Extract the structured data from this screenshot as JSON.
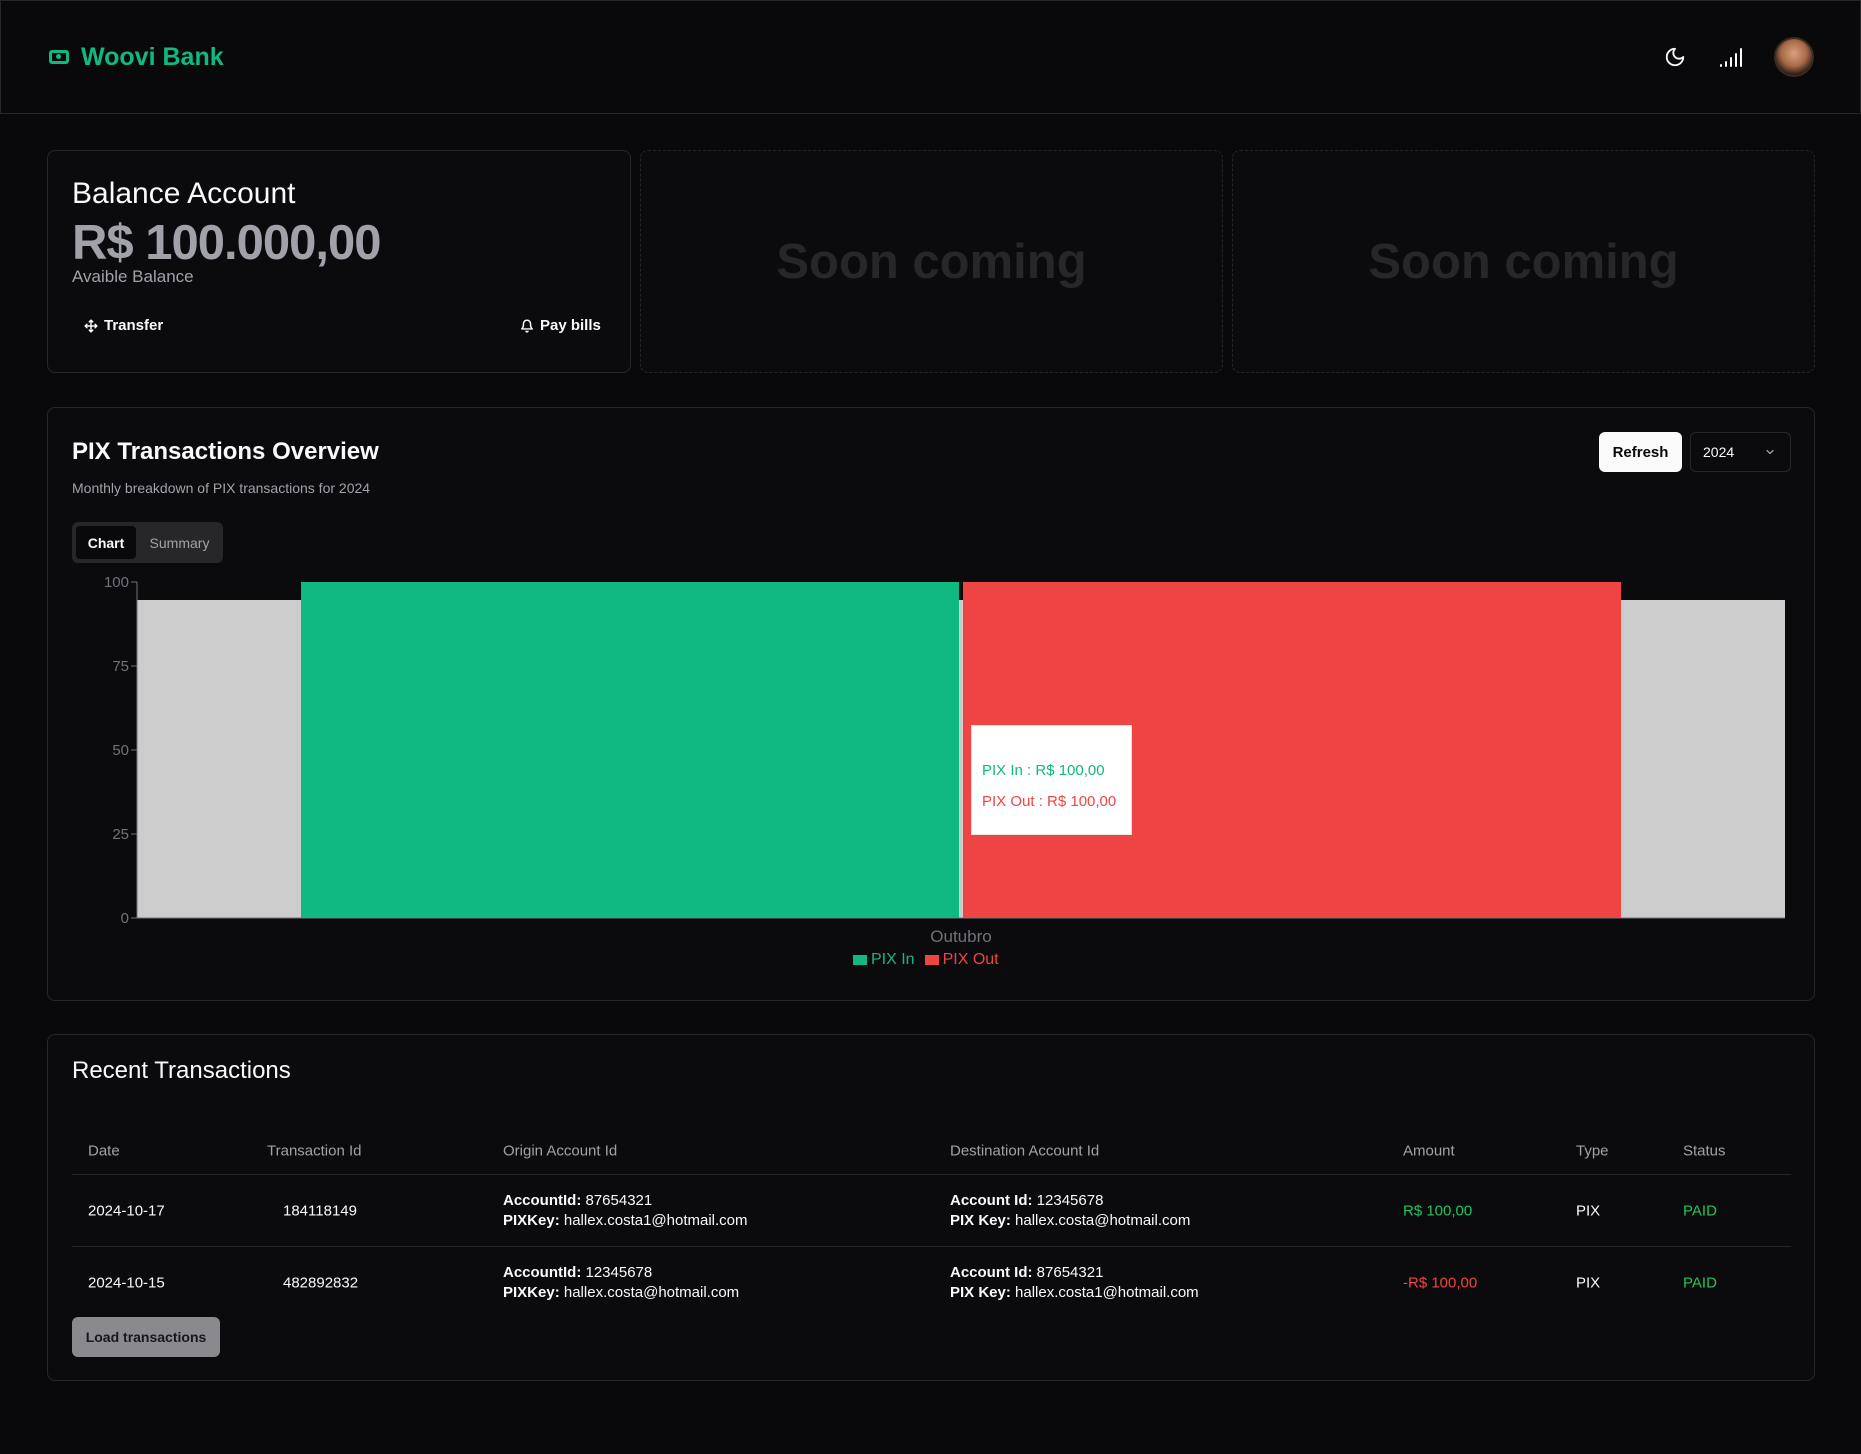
{
  "header": {
    "brand": "Woovi Bank",
    "icons": [
      "money-icon",
      "moon-icon",
      "signal-icon"
    ]
  },
  "balance": {
    "title": "Balance Account",
    "amount": "R$ 100.000,00",
    "subtitle": "Avaible Balance",
    "transfer_label": "Transfer",
    "pay_bills_label": "Pay bills"
  },
  "placeholders": {
    "soon_1": "Soon coming",
    "soon_2": "Soon coming"
  },
  "overview": {
    "title": "PIX Transactions Overview",
    "subtitle": "Monthly breakdown of PIX transactions for 2024",
    "refresh_label": "Refresh",
    "year_selected": "2024",
    "tabs": [
      {
        "label": "Chart",
        "active": true
      },
      {
        "label": "Summary",
        "active": false
      }
    ],
    "tooltip": {
      "title": "Outubro",
      "pix_in": "PIX In : R$ 100,00",
      "pix_out": "PIX Out : R$ 100,00"
    }
  },
  "chart_data": {
    "type": "bar",
    "categories": [
      "Outubro"
    ],
    "series": [
      {
        "name": "PIX In",
        "values": [
          100
        ],
        "color": "#10b981"
      },
      {
        "name": "PIX Out",
        "values": [
          100
        ],
        "color": "#ef4444"
      }
    ],
    "ylim": [
      0,
      100
    ],
    "yticks": [
      0,
      25,
      50,
      75,
      100
    ],
    "legend": "bottom",
    "grid": false
  },
  "transactions": {
    "title": "Recent Transactions",
    "columns": [
      "Date",
      "Transaction Id",
      "Origin Account Id",
      "Destination Account Id",
      "Amount",
      "Type",
      "Status"
    ],
    "rows": [
      {
        "date": "2024-10-17",
        "id": "184118149",
        "origin_label_1": "AccountId:",
        "origin_value_1": "87654321",
        "origin_label_2": "PIXKey:",
        "origin_value_2": "hallex.costa1@hotmail.com",
        "dest_label_1": "Account Id:",
        "dest_value_1": "12345678",
        "dest_label_2": "PIX Key:",
        "dest_value_2": "hallex.costa@hotmail.com",
        "amount": "R$ 100,00",
        "amount_color": "#22c55e",
        "type": "PIX",
        "status": "PAID"
      },
      {
        "date": "2024-10-15",
        "id": "482892832",
        "origin_label_1": "AccountId:",
        "origin_value_1": "12345678",
        "origin_label_2": "PIXKey:",
        "origin_value_2": "hallex.costa@hotmail.com",
        "dest_label_1": "Account Id:",
        "dest_value_1": "87654321",
        "dest_label_2": "PIX Key:",
        "dest_value_2": "hallex.costa1@hotmail.com",
        "amount": "-R$ 100,00",
        "amount_color": "#ef4444",
        "type": "PIX",
        "status": "PAID"
      }
    ],
    "load_label": "Load transactions"
  },
  "colors": {
    "accent": "#10b981",
    "positive": "#22c55e",
    "negative": "#ef4444",
    "background": "#09090b"
  }
}
